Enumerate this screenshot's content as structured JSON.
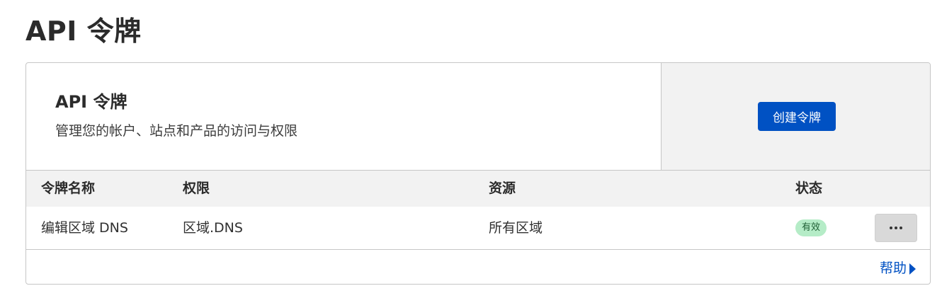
{
  "page": {
    "title": "API 令牌"
  },
  "card": {
    "title": "API 令牌",
    "description": "管理您的帐户、站点和产品的访问与权限",
    "create_button": "创建令牌"
  },
  "table": {
    "columns": [
      "令牌名称",
      "权限",
      "资源",
      "状态"
    ],
    "rows": [
      {
        "name": "编辑区域 DNS",
        "permission": "区域.DNS",
        "resource": "所有区域",
        "status": "有效",
        "status_color": "#b5ecc7",
        "actions_icon": "more-horizontal-icon"
      }
    ]
  },
  "footer": {
    "help_label": "帮助",
    "help_icon": "caret-right-icon"
  },
  "colors": {
    "accent": "#0051c3",
    "header_bg": "#f2f2f2",
    "border": "#c6c6c6"
  }
}
